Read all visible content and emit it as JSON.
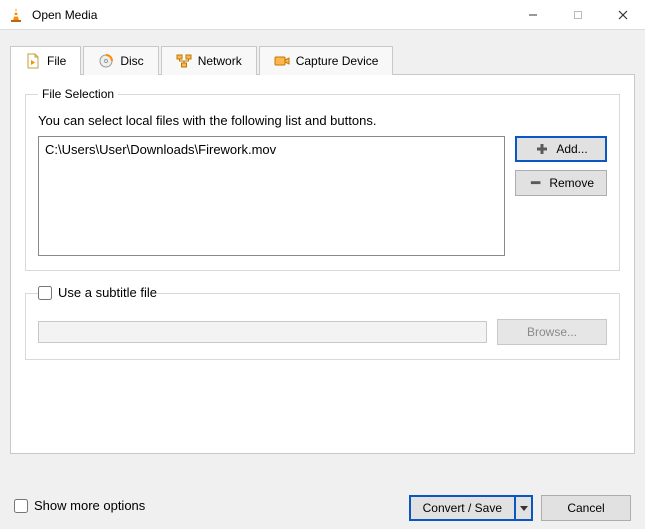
{
  "window": {
    "title": "Open Media"
  },
  "tabs": {
    "file": "File",
    "disc": "Disc",
    "network": "Network",
    "capture": "Capture Device"
  },
  "file_selection": {
    "legend": "File Selection",
    "hint": "You can select local files with the following list and buttons.",
    "items": [
      "C:\\Users\\User\\Downloads\\Firework.mov"
    ],
    "add_label": "Add...",
    "remove_label": "Remove"
  },
  "subtitle": {
    "checkbox_label": "Use a subtitle file",
    "browse_label": "Browse..."
  },
  "more_options_label": "Show more options",
  "footer": {
    "convert_label": "Convert / Save",
    "cancel_label": "Cancel"
  }
}
